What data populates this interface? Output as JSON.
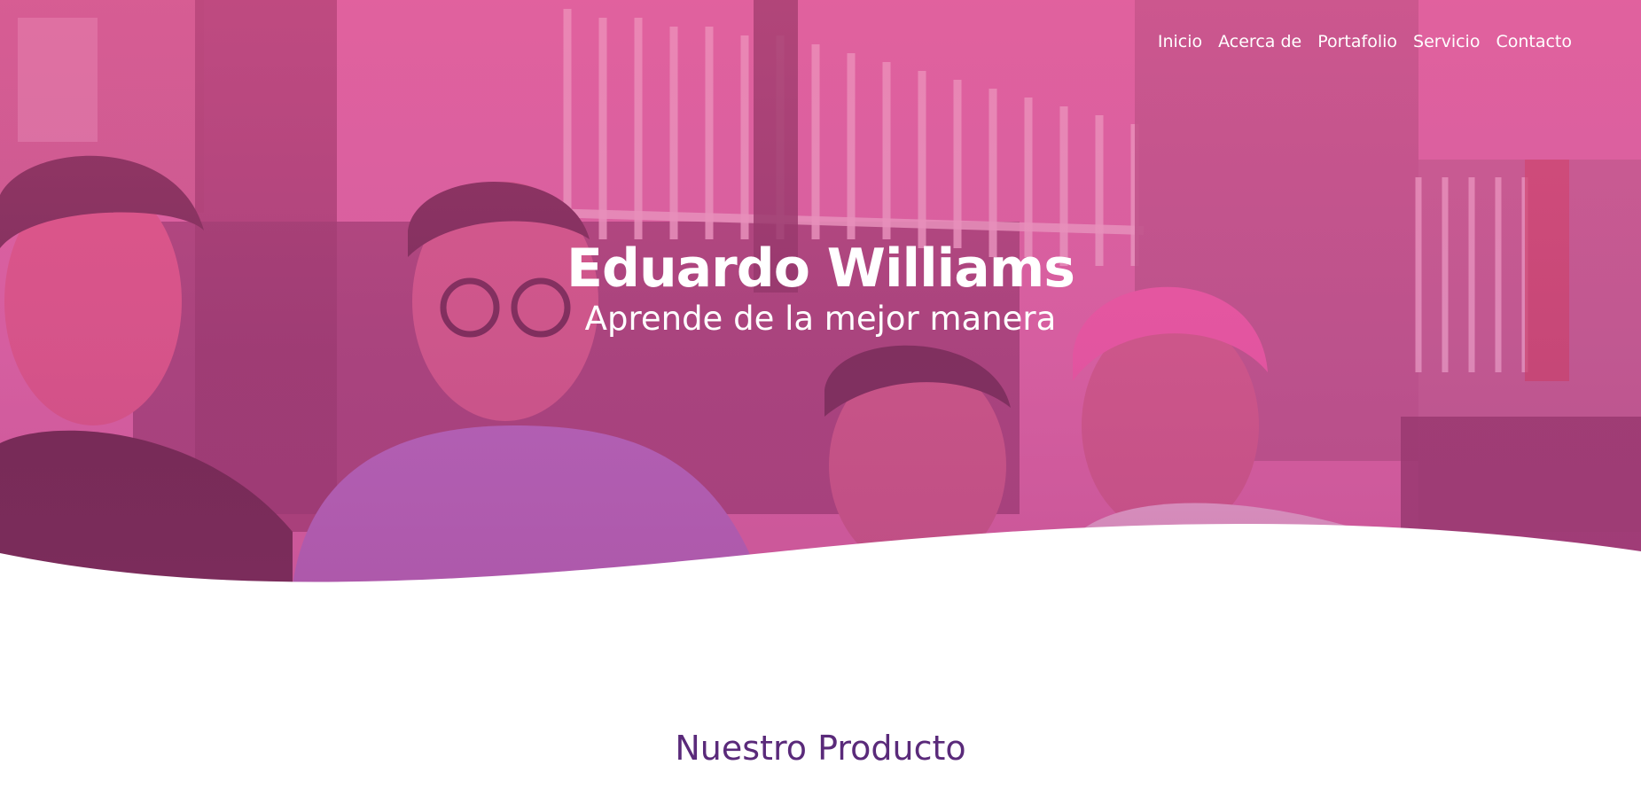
{
  "nav": {
    "items": [
      {
        "label": "Inicio"
      },
      {
        "label": "Acerca de"
      },
      {
        "label": "Portafolio"
      },
      {
        "label": "Servicio"
      },
      {
        "label": "Contacto"
      }
    ]
  },
  "hero": {
    "title": "Eduardo Williams",
    "subtitle": "Aprende de la mejor manera"
  },
  "section": {
    "title": "Nuestro Producto"
  },
  "colors": {
    "overlay": "#e0609e",
    "section_title": "#5a2a7a",
    "nav_text": "#ffffff"
  }
}
